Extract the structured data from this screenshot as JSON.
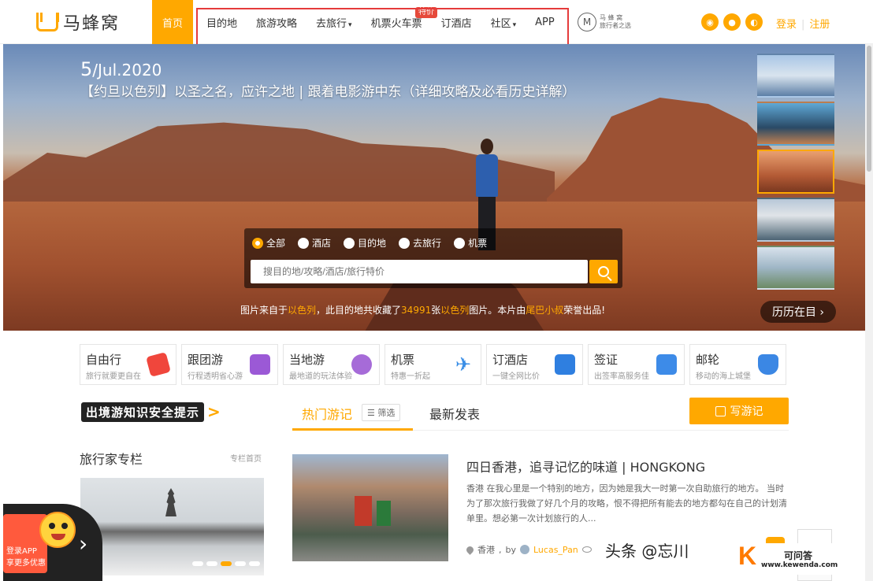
{
  "header": {
    "logo_text": "马蜂窝",
    "nav_home": "首页",
    "nav_items": [
      {
        "label": "目的地",
        "caret": false
      },
      {
        "label": "旅游攻略",
        "caret": false
      },
      {
        "label": "去旅行",
        "caret": true
      },
      {
        "label": "机票火车票",
        "caret": false
      },
      {
        "label": "订酒店",
        "caret": false
      },
      {
        "label": "社区",
        "caret": true
      },
      {
        "label": "APP",
        "caret": false
      }
    ],
    "badge": "特价",
    "brand2_line1": "马 蜂 窝",
    "brand2_line2": "旅行者之选",
    "login": "登录",
    "register": "注册"
  },
  "hero": {
    "date_day": "5",
    "date_rest": "/Jul.2020",
    "title": "【约旦以色列】以圣之名，应许之地 | 跟着电影游中东（详细攻略及必看历史详解）",
    "history_button": "历历在目 ›",
    "credit_prefix": "图片来自于",
    "credit_place": "以色列",
    "credit_mid": "，此目的地共收藏了",
    "credit_count": "34991",
    "credit_mid2": "张",
    "credit_place2": "以色列",
    "credit_mid3": "图片。本片由",
    "credit_author": "尾巴小叔",
    "credit_suffix": "荣誉出品!"
  },
  "search": {
    "options": [
      {
        "label": "全部",
        "selected": true
      },
      {
        "label": "酒店",
        "selected": false
      },
      {
        "label": "目的地",
        "selected": false
      },
      {
        "label": "去旅行",
        "selected": false
      },
      {
        "label": "机票",
        "selected": false
      }
    ],
    "placeholder": "搜目的地/攻略/酒店/旅行特价"
  },
  "categories": [
    {
      "name": "自由行",
      "sub": "旅行就要更自在",
      "color": "#f0463c"
    },
    {
      "name": "跟团游",
      "sub": "行程透明省心游",
      "color": "#9b59d6"
    },
    {
      "name": "当地游",
      "sub": "最地道的玩法体验",
      "color": "#a66bd8"
    },
    {
      "name": "机票",
      "sub": "特惠一折起",
      "color": "#3a8ee6"
    },
    {
      "name": "订酒店",
      "sub": "一键全网比价",
      "color": "#2f7fe0"
    },
    {
      "name": "签证",
      "sub": "出签率高服务佳",
      "color": "#3d8be8"
    },
    {
      "name": "邮轮",
      "sub": "移动的海上城堡",
      "color": "#3b87e4"
    }
  ],
  "safety_text": "出境游知识安全提示",
  "tabs": {
    "hot": "热门游记",
    "filter": "☰ 筛选",
    "new": "最新发表",
    "write": "写游记"
  },
  "column": {
    "title": "旅行家专栏",
    "link": "专栏首页"
  },
  "article": {
    "title": "四日香港，追寻记忆的味道 | HONGKONG",
    "desc": "香港 在我心里是一个特别的地方，因为她是我大一时第一次自助旅行的地方。 当时为了那次旅行我做了好几个月的攻略，恨不得把所有能去的地方都勾在自己的计划清单里。想必第一次计划旅行的人...",
    "location": "香港",
    "by": "by",
    "author": "Lucas_Pan"
  },
  "app_promo": {
    "line1": "登录APP",
    "line2": "享更多优惠"
  },
  "watermarks": {
    "toutiao": "头条 @忘川",
    "site_name": "可问答",
    "site_url": "www.kewenda.com"
  }
}
